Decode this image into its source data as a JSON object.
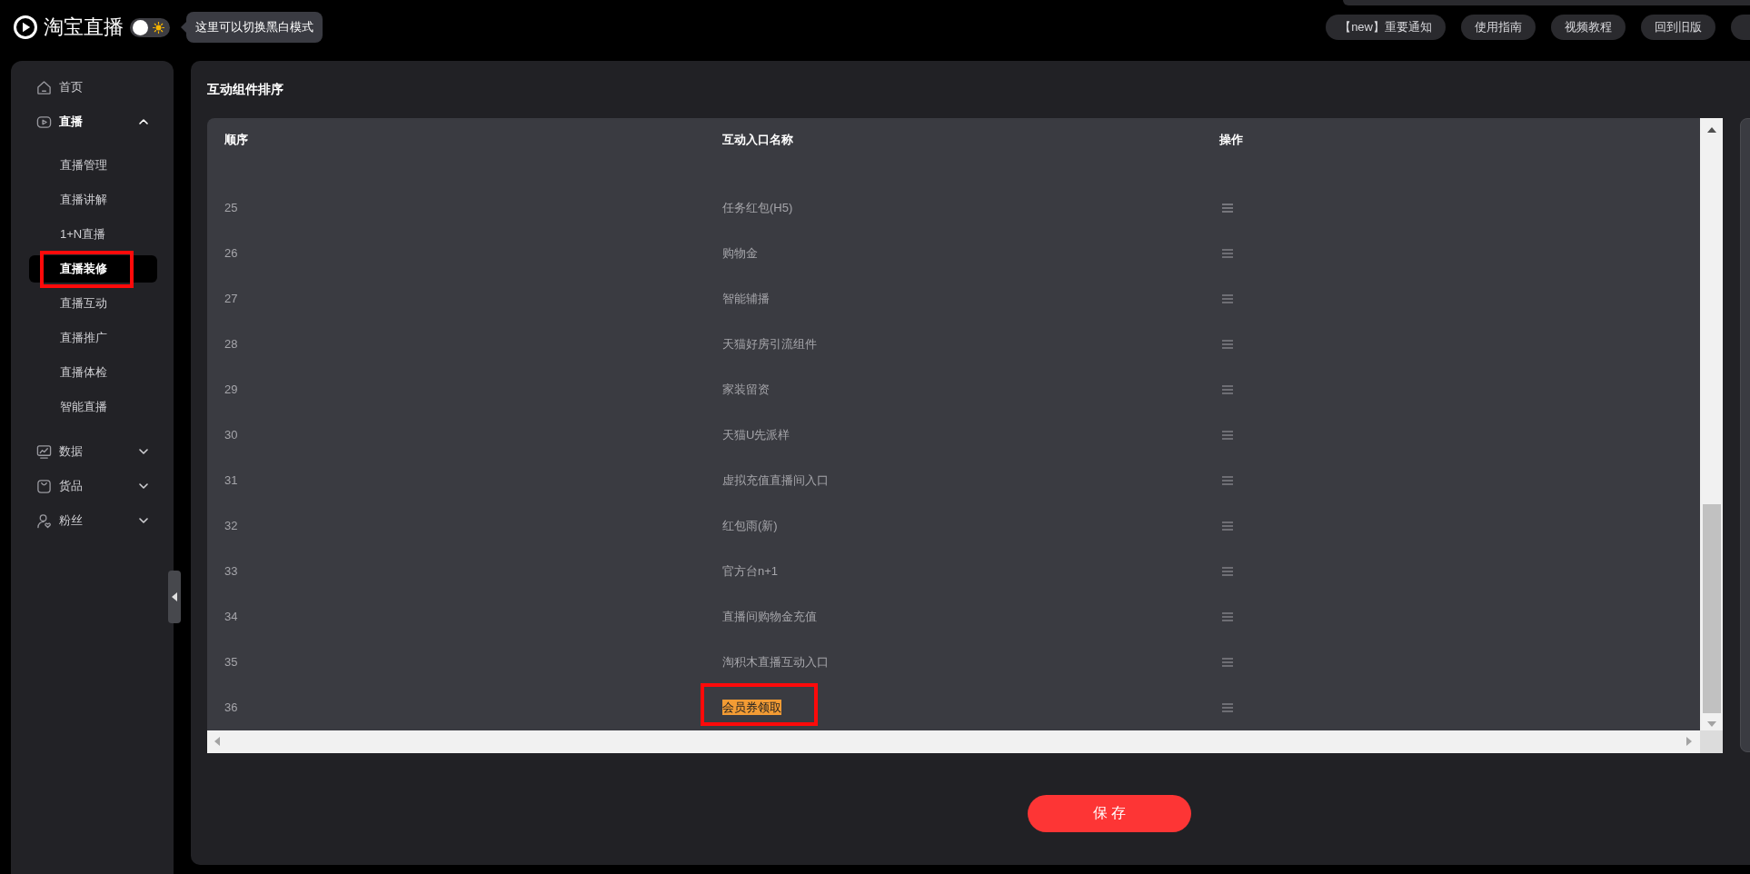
{
  "header": {
    "logo_text": "淘宝直播",
    "theme_toggle": {
      "on": false
    },
    "tooltip": "这里可以切换黑白模式",
    "buttons": [
      "【new】重要通知",
      "使用指南",
      "视频教程",
      "回到旧版"
    ]
  },
  "sidebar": {
    "home": {
      "label": "首页"
    },
    "groups": [
      {
        "label": "直播",
        "expanded": true,
        "children": [
          {
            "label": "直播管理",
            "selected": false,
            "annotated": false
          },
          {
            "label": "直播讲解",
            "selected": false,
            "annotated": false
          },
          {
            "label": "1+N直播",
            "selected": false,
            "annotated": false
          },
          {
            "label": "直播装修",
            "selected": true,
            "annotated": true
          },
          {
            "label": "直播互动",
            "selected": false,
            "annotated": false
          },
          {
            "label": "直播推广",
            "selected": false,
            "annotated": false
          },
          {
            "label": "直播体检",
            "selected": false,
            "annotated": false
          },
          {
            "label": "智能直播",
            "selected": false,
            "annotated": false
          }
        ]
      },
      {
        "label": "数据",
        "expanded": false
      },
      {
        "label": "货品",
        "expanded": false
      },
      {
        "label": "粉丝",
        "expanded": false
      }
    ]
  },
  "content": {
    "title": "互动组件排序",
    "table": {
      "columns": [
        "顺序",
        "互动入口名称",
        "操作"
      ],
      "rows": [
        {
          "order": "25",
          "name": "任务红包(H5)",
          "highlighted": false,
          "annotated": false
        },
        {
          "order": "26",
          "name": "购物金",
          "highlighted": false,
          "annotated": false
        },
        {
          "order": "27",
          "name": "智能辅播",
          "highlighted": false,
          "annotated": false
        },
        {
          "order": "28",
          "name": "天猫好房引流组件",
          "highlighted": false,
          "annotated": false
        },
        {
          "order": "29",
          "name": "家装留资",
          "highlighted": false,
          "annotated": false
        },
        {
          "order": "30",
          "name": "天猫U先派样",
          "highlighted": false,
          "annotated": false
        },
        {
          "order": "31",
          "name": "虚拟充值直播间入口",
          "highlighted": false,
          "annotated": false
        },
        {
          "order": "32",
          "name": "红包雨(新)",
          "highlighted": false,
          "annotated": false
        },
        {
          "order": "33",
          "name": "官方台n+1",
          "highlighted": false,
          "annotated": false
        },
        {
          "order": "34",
          "name": "直播间购物金充值",
          "highlighted": false,
          "annotated": false
        },
        {
          "order": "35",
          "name": "淘积木直播互动入口",
          "highlighted": false,
          "annotated": false
        },
        {
          "order": "36",
          "name": "会员券领取",
          "highlighted": true,
          "annotated": true
        }
      ]
    },
    "save_button": "保 存"
  }
}
